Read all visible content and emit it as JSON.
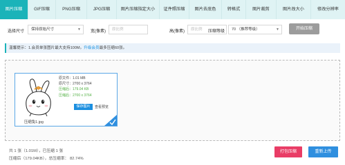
{
  "tabs": [
    {
      "label": "图片压缩",
      "active": true
    },
    {
      "label": "GIF压缩",
      "active": false
    },
    {
      "label": "PNG压缩",
      "active": false
    },
    {
      "label": "JPG压缩",
      "active": false
    },
    {
      "label": "图片压缩指定大小",
      "active": false
    },
    {
      "label": "证件照压缩",
      "active": false
    },
    {
      "label": "图片去底色",
      "active": false
    },
    {
      "label": "转格式",
      "active": false
    },
    {
      "label": "图片裁剪",
      "active": false
    },
    {
      "label": "图片改大小",
      "active": false
    },
    {
      "label": "修改分辨率",
      "active": false
    }
  ],
  "toolbar": {
    "size_label": "选择尺寸",
    "size_value": "保持原始尺寸",
    "width_label": "宽(像素)",
    "width_placeholder": "原比例",
    "height_label": "高(像素)",
    "height_placeholder": "原比例",
    "level_label": "压缩等级",
    "level_value": "70 （推荐等级）",
    "start_button": "开始压缩"
  },
  "tip": {
    "prefix": "温馨提示：1.会员单张图片最大支持100M。",
    "vip_link": "升级会员",
    "suffix": "最多压缩60张。"
  },
  "file": {
    "name": "压缩兔1.jpg",
    "original_size": "原文件：1.01 MB",
    "original_dims": "原尺寸：2700 x 3764",
    "compressed_size": "压缩后：179.04 KB",
    "compressed_dims": "压缩后：2700 x 3764",
    "save_button": "保存图片",
    "preview_link": "查看预览"
  },
  "summary": {
    "line1": "共 1 张（1.01M），已压缩 1 张",
    "line2": "压缩后（179.04KB），总压缩率：  82.74%"
  },
  "footer": {
    "pack_button": "打包压缩",
    "reupload_button": "重新上传"
  },
  "colors": {
    "accent": "#1bb3b9",
    "tab_bg": "#dff3f4",
    "save_blue": "#1b8fe0",
    "pack_red": "#e93d66",
    "reupload_blue": "#2f8fdf"
  }
}
